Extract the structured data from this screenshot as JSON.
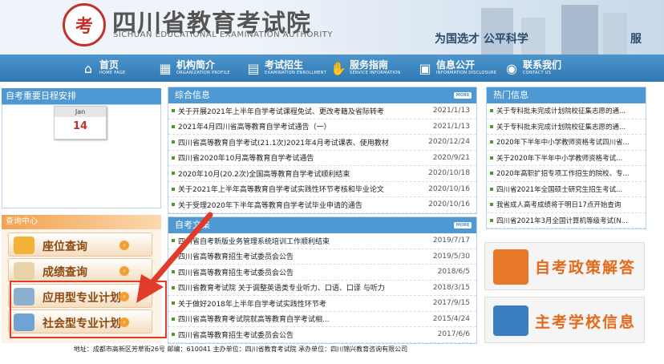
{
  "header": {
    "logo_glyph": "考",
    "title": "四川省教育考试院",
    "subtitle": "SICHUAN EDUCATIONAL EXAMINATION AUTHORITY",
    "slogan": "为国选才 公平科学",
    "slogan_end": "服"
  },
  "nav": [
    {
      "cn": "首页",
      "en": "HOME PAGE",
      "icon": "home-icon"
    },
    {
      "cn": "机构简介",
      "en": "ORGANIZATION PROFILE",
      "icon": "org-chart-icon"
    },
    {
      "cn": "考试招生",
      "en": "EXAMINATION ENROLLMENT",
      "icon": "document-icon"
    },
    {
      "cn": "服务指南",
      "en": "SERVICE INFORMATION",
      "icon": "handshake-icon"
    },
    {
      "cn": "信息公开",
      "en": "INFORMATION DISCLOSURE",
      "icon": "monitor-icon"
    },
    {
      "cn": "联系我们",
      "en": "CONTACT US",
      "icon": "globe-icon"
    }
  ],
  "schedule": {
    "title": "自考重要日程安排",
    "month": "Jan",
    "day": "14"
  },
  "query": {
    "title": "查询中心",
    "buttons": [
      "座位查询",
      "成绩查询",
      "应用型专业计划",
      "社会型专业计划"
    ]
  },
  "news": {
    "title": "综合信息",
    "more": "MORE",
    "rows": [
      {
        "text": "关于开展2021年上半年自学考试课程免试、更改考籍及省际转考",
        "date": "2021/1/13"
      },
      {
        "text": "2021年4月四川省高等教育自学考试通告（一）",
        "date": "2021/1/13"
      },
      {
        "text": "四川省高等教育自学考试(21.1次)2021年4月考试课表、使用教材",
        "date": "2020/12/24"
      },
      {
        "text": "四川省2020年10月高等教育自学考试通告",
        "date": "2020/9/21"
      },
      {
        "text": "2020年10月(20.2次)全国高等教育自学考试顺利结束",
        "date": "2020/10/18"
      },
      {
        "text": "关于2021年上半年高等教育自学考试实践性环节考核和毕业论文",
        "date": "2020/10/16"
      },
      {
        "text": "关于受理2020年下半年高等教育自学考试毕业申请的通告",
        "date": "2020/10/16"
      }
    ]
  },
  "selfexam": {
    "title": "自考文集",
    "more": "MORE",
    "rows": [
      {
        "text": "四川省自考新版业务管理系统培训工作顺利结束",
        "date": "2019/7/17"
      },
      {
        "text": "四川省高等教育招生考试委员会公告",
        "date": "2019/5/30"
      },
      {
        "text": "四川省高等教育招生考试委员会公告",
        "date": "2018/6/5"
      },
      {
        "text": "四川省教育考试院 关于调整英语类专业听力、口语、口译 与听力",
        "date": "2018/3/15"
      },
      {
        "text": "关于做好2018年上半年自学考试实践性环节考",
        "date": "2017/9/15"
      },
      {
        "text": "四川省高等教育考试院就高等教育自学考试相...",
        "date": "2015/4/24"
      },
      {
        "text": "四川省高等教育招生考试委员会公告",
        "date": "2017/6/6"
      }
    ]
  },
  "hot": {
    "title": "热门信息",
    "rows": [
      "关于专科批未完成计划院校征集志愿的通...",
      "关于专科批未完成计划院校征集志愿的通...",
      "2020年下半年中小学教师资格考试四川省...",
      "关于2020年下半年中小学教师资格考试...",
      "2020年高职扩招专项工作招生的院校、专...",
      "四川省2021年全国硕士研究生招生考试...",
      "我省成人高考成绩将于明日17点开始查询",
      "四川省2021年3月全国计算机等级考试(N..."
    ]
  },
  "banners": [
    "自考政策解答",
    "主考学校信息"
  ],
  "footer": "地址：成都市高新区芳草街26号 邮编：610041 主办单位：四川省教育考试院 承办单位：四川锦兴教育咨询有限公司"
}
